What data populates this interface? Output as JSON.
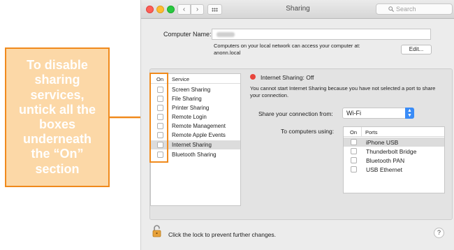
{
  "annotation": {
    "text": "To disable\nsharing\nservices,\nuntick all the\nboxes\nunderneath\nthe “On”\nsection",
    "color": "#f08a1c"
  },
  "window": {
    "title": "Sharing",
    "search_placeholder": "Search",
    "back_symbol": "‹",
    "forward_symbol": "›"
  },
  "computer_name": {
    "label": "Computer Name:",
    "description": "Computers on your local network can access your computer at:\nanonn.local",
    "edit_label": "Edit..."
  },
  "services": {
    "header_on": "On",
    "header_service": "Service",
    "items": [
      {
        "label": "Screen Sharing",
        "checked": false
      },
      {
        "label": "File Sharing",
        "checked": false
      },
      {
        "label": "Printer Sharing",
        "checked": false
      },
      {
        "label": "Remote Login",
        "checked": false
      },
      {
        "label": "Remote Management",
        "checked": false
      },
      {
        "label": "Remote Apple Events",
        "checked": false
      },
      {
        "label": "Internet Sharing",
        "checked": false,
        "selected": true
      },
      {
        "label": "Bluetooth Sharing",
        "checked": false
      }
    ]
  },
  "detail": {
    "status": "Internet Sharing: Off",
    "status_color": "#e8453c",
    "message": "You cannot start Internet Sharing because you have not selected a port to share your connection.",
    "share_from_label": "Share your connection from:",
    "share_from_value": "Wi-Fi",
    "to_computers_label": "To computers using:",
    "ports_header_on": "On",
    "ports_header_ports": "Ports",
    "ports": [
      {
        "label": "iPhone USB",
        "checked": false,
        "selected": true
      },
      {
        "label": "Thunderbolt Bridge",
        "checked": false
      },
      {
        "label": "Bluetooth PAN",
        "checked": false
      },
      {
        "label": "USB Ethernet",
        "checked": false
      }
    ]
  },
  "footer": {
    "lock_text": "Click the lock to prevent further changes.",
    "help_label": "?"
  }
}
